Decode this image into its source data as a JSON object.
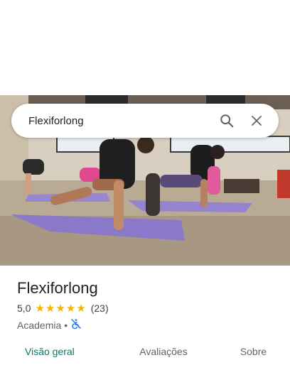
{
  "search": {
    "query": "Flexiforlong"
  },
  "place": {
    "name": "Flexiforlong",
    "rating": "5,0",
    "stars": [
      "★",
      "★",
      "★",
      "★",
      "★"
    ],
    "review_count": "(23)",
    "category": "Academia",
    "separator": "•",
    "status_icon": "no-wheelchair-access-icon"
  },
  "tabs": [
    {
      "label": "Visão geral"
    },
    {
      "label": "Avaliações"
    },
    {
      "label": "Sobre"
    }
  ],
  "colors": {
    "accent": "#00796b",
    "star": "#f4b400",
    "access_icon": "#1a73e8"
  }
}
